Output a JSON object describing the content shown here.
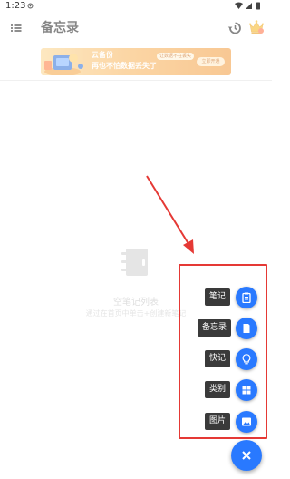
{
  "status_bar": {
    "time": "1:23"
  },
  "app_bar": {
    "title": "备忘录",
    "menu_icon": "list-menu-icon",
    "history_icon": "history-icon",
    "crown_icon": "crown-icon"
  },
  "banner": {
    "line1": "云备份",
    "line2": "再也不怕数据丢失了",
    "pill": "让数据不在丢失",
    "cta": "立即开通"
  },
  "empty_state": {
    "title": "空笔记列表",
    "hint": "通过在首页中单击+创建新笔记"
  },
  "fab_menu": {
    "items": [
      {
        "label": "笔记",
        "icon": "clipboard-icon"
      },
      {
        "label": "备忘录",
        "icon": "note-icon"
      },
      {
        "label": "快记",
        "icon": "lightbulb-icon"
      },
      {
        "label": "类别",
        "icon": "grid-icon"
      },
      {
        "label": "图片",
        "icon": "image-icon"
      }
    ],
    "main_icon": "close-icon"
  },
  "colors": {
    "accent": "#2979ff",
    "annotation": "#e53935",
    "label_bg": "#3a3a3a",
    "banner_start": "#fbd58e",
    "banner_end": "#f39b3c"
  }
}
